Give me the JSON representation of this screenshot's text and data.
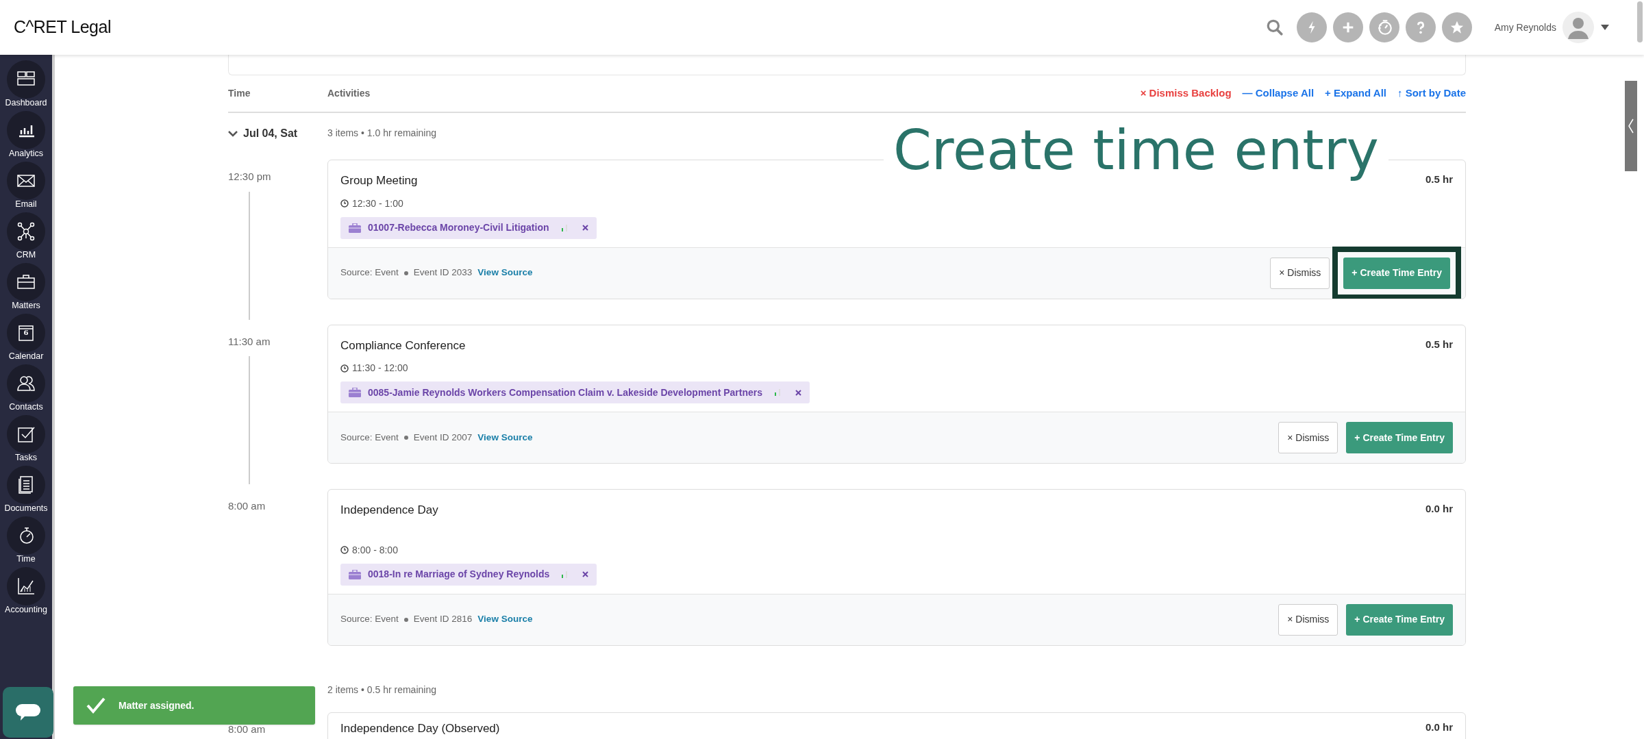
{
  "header": {
    "logo": "C^RET Legal",
    "user_name": "Amy Reynolds"
  },
  "sidebar": {
    "items": [
      {
        "label": "Dashboard"
      },
      {
        "label": "Analytics"
      },
      {
        "label": "Email"
      },
      {
        "label": "CRM"
      },
      {
        "label": "Matters"
      },
      {
        "label": "Calendar",
        "badge": "6"
      },
      {
        "label": "Contacts"
      },
      {
        "label": "Tasks"
      },
      {
        "label": "Documents"
      },
      {
        "label": "Time"
      },
      {
        "label": "Accounting"
      }
    ]
  },
  "table": {
    "columns": [
      "Time",
      "Activities"
    ],
    "actions": [
      {
        "label": "× Dismiss Backlog",
        "kind": "danger"
      },
      {
        "label": "— Collapse All",
        "kind": "link"
      },
      {
        "label": "+ Expand All",
        "kind": "link"
      },
      {
        "label": "↑ Sort by Date",
        "kind": "link"
      }
    ]
  },
  "groups": [
    {
      "date": "Jul 04, Sat",
      "expanded": true,
      "summary": "3 items • 1.0 hr remaining",
      "entries": [
        {
          "time": "12:30 pm",
          "title": "Group Meeting",
          "hours": "0.5 hr",
          "range": "12:30 - 1:00",
          "matter": "01007-Rebecca Moroney-Civil Litigation",
          "source": "Source: Event",
          "event_id": "Event ID 2033",
          "view_source": "View Source",
          "dismiss": "× Dismiss",
          "create": "+ Create Time Entry",
          "highlighted": true
        },
        {
          "time": "11:30 am",
          "title": "Compliance Conference",
          "hours": "0.5 hr",
          "range": "11:30 - 12:00",
          "matter": "0085-Jamie Reynolds Workers Compensation Claim v. Lakeside Development Partners",
          "source": "Source: Event",
          "event_id": "Event ID 2007",
          "view_source": "View Source",
          "dismiss": "× Dismiss",
          "create": "+ Create Time Entry",
          "highlighted": false
        },
        {
          "time": "8:00 am",
          "title": "Independence Day",
          "hours": "0.0 hr",
          "range": "8:00 - 8:00",
          "matter": "0018-In re Marriage of Sydney Reynolds",
          "source": "Source: Event",
          "event_id": "Event ID 2816",
          "view_source": "View Source",
          "dismiss": "× Dismiss",
          "create": "+ Create Time Entry",
          "highlighted": false
        }
      ]
    },
    {
      "summary": "2 items • 0.5 hr remaining",
      "entries": [
        {
          "time": "8:00 am",
          "title": "Independence Day (Observed)",
          "hours": "0.0 hr"
        }
      ]
    }
  ],
  "callout": "Create time entry",
  "toast": {
    "message": "Matter assigned."
  }
}
